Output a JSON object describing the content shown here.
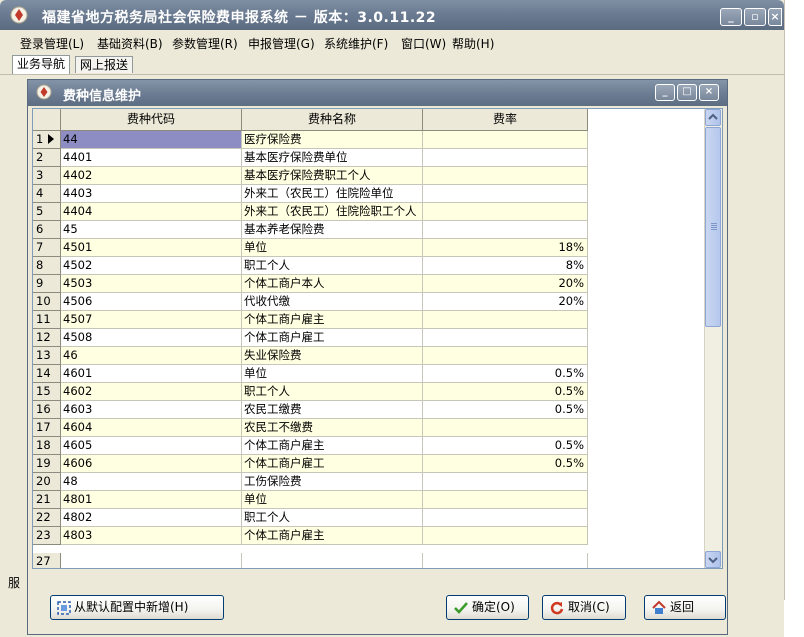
{
  "main_window": {
    "title": "福建省地方税务局社会保险费申报系统 － 版本：3.0.11.22",
    "menu": [
      "登录管理(L)",
      "基础资料(B)",
      "参数管理(R)",
      "申报管理(G)",
      "系统维护(F)",
      "窗口(W)",
      "帮助(H)"
    ],
    "tabs": [
      "业务导航",
      "网上报送"
    ],
    "status_text": "服"
  },
  "dialog": {
    "title": "费种信息维护",
    "columns": [
      "费种代码",
      "费种名称",
      "费率"
    ],
    "rows": [
      {
        "idx": "1",
        "code": "44",
        "name": "医疗保险费",
        "rate": ""
      },
      {
        "idx": "2",
        "code": "4401",
        "name": "基本医疗保险费单位",
        "rate": ""
      },
      {
        "idx": "3",
        "code": "4402",
        "name": "基本医疗保险费职工个人",
        "rate": ""
      },
      {
        "idx": "4",
        "code": "4403",
        "name": "外来工（农民工）住院险单位",
        "rate": ""
      },
      {
        "idx": "5",
        "code": "4404",
        "name": "外来工（农民工）住院险职工个人",
        "rate": ""
      },
      {
        "idx": "6",
        "code": "45",
        "name": "基本养老保险费",
        "rate": ""
      },
      {
        "idx": "7",
        "code": "4501",
        "name": "单位",
        "rate": "18%"
      },
      {
        "idx": "8",
        "code": "4502",
        "name": "职工个人",
        "rate": "8%"
      },
      {
        "idx": "9",
        "code": "4503",
        "name": "个体工商户本人",
        "rate": "20%"
      },
      {
        "idx": "10",
        "code": "4506",
        "name": "代收代缴",
        "rate": "20%"
      },
      {
        "idx": "11",
        "code": "4507",
        "name": "个体工商户雇主",
        "rate": ""
      },
      {
        "idx": "12",
        "code": "4508",
        "name": "个体工商户雇工",
        "rate": ""
      },
      {
        "idx": "13",
        "code": "46",
        "name": "失业保险费",
        "rate": ""
      },
      {
        "idx": "14",
        "code": "4601",
        "name": "单位",
        "rate": "0.5%"
      },
      {
        "idx": "15",
        "code": "4602",
        "name": "职工个人",
        "rate": "0.5%"
      },
      {
        "idx": "16",
        "code": "4603",
        "name": "农民工缴费",
        "rate": "0.5%"
      },
      {
        "idx": "17",
        "code": "4604",
        "name": "农民工不缴费",
        "rate": ""
      },
      {
        "idx": "18",
        "code": "4605",
        "name": "个体工商户雇主",
        "rate": "0.5%"
      },
      {
        "idx": "19",
        "code": "4606",
        "name": "个体工商户雇工",
        "rate": "0.5%"
      },
      {
        "idx": "20",
        "code": "48",
        "name": "工伤保险费",
        "rate": ""
      },
      {
        "idx": "21",
        "code": "4801",
        "name": "单位",
        "rate": ""
      },
      {
        "idx": "22",
        "code": "4802",
        "name": "职工个人",
        "rate": ""
      },
      {
        "idx": "23",
        "code": "4803",
        "name": "个体工商户雇主",
        "rate": ""
      }
    ],
    "partial_row": {
      "idx": "27",
      "code": "",
      "name": "",
      "rate": ""
    },
    "buttons": {
      "add_from_default": "从默认配置中新增(H)",
      "ok": "确定(O)",
      "cancel": "取消(C)",
      "back": "返回"
    }
  },
  "colors": {
    "title_bar": "#6d7d93",
    "row_yellow": "#ffffe1",
    "selection": "#8d8dc4"
  }
}
